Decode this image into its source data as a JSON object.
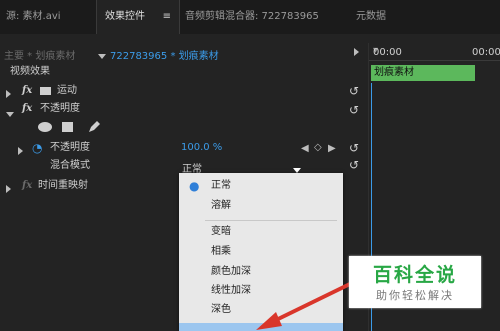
{
  "tabs": [
    {
      "label": "源: 素材.avi"
    },
    {
      "label": "效果控件",
      "active": true
    },
    {
      "label": "音频剪辑混合器: 722783965"
    },
    {
      "label": "元数据"
    }
  ],
  "active_tab_menu": "≡",
  "source_header": {
    "master": "主要 * 划痕素材",
    "sequence": "722783965 * 划痕素材"
  },
  "timeline": {
    "time_start": "00:00",
    "time_end": "00:00",
    "clip_label": "划痕素材"
  },
  "effects_panel": {
    "section_title": "视频效果",
    "motion_label": "运动",
    "opacity_group_label": "不透明度",
    "opacity_property_label": "不透明度",
    "opacity_value": "100.0 %",
    "blend_mode_label": "混合模式",
    "blend_mode_value": "正常",
    "time_remap_label": "时间重映射",
    "fx_glyph": "fx"
  },
  "dropdown_options": [
    {
      "label": "正常",
      "selected": true
    },
    {
      "label": "溶解"
    },
    {
      "label": "变暗"
    },
    {
      "label": "相乘"
    },
    {
      "label": "颜色加深"
    },
    {
      "label": "线性加深"
    },
    {
      "label": "深色"
    }
  ],
  "watermark": {
    "title": "百科全说",
    "subtitle": "助你轻松解决"
  },
  "colors": {
    "accent_blue": "#3b9be8",
    "clip_green": "#5cb85c",
    "watermark_green": "#28a745",
    "arrow_red": "#d9362b"
  }
}
